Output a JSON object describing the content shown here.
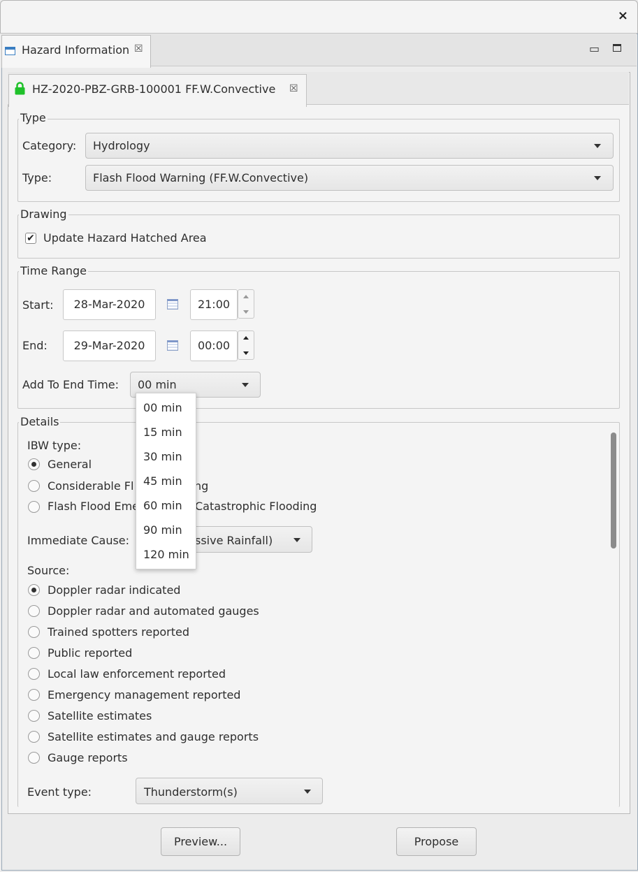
{
  "window": {
    "close_glyph": "×"
  },
  "view": {
    "tab_label": "Hazard Information",
    "tab_close_glyph": "☒",
    "minimize_glyph": "▭"
  },
  "hazard_tab": {
    "label": "HZ-2020-PBZ-GRB-100001 FF.W.Convective",
    "close_glyph": "☒",
    "lock_color": "#1fc12a"
  },
  "type_group": {
    "legend": "Type",
    "category_label": "Category:",
    "category_value": "Hydrology",
    "type_label": "Type:",
    "type_value": "Flash Flood Warning (FF.W.Convective)"
  },
  "drawing_group": {
    "legend": "Drawing",
    "update_hatched_label": "Update Hazard Hatched Area",
    "update_hatched_checked": true,
    "check_glyph": "✔"
  },
  "time_range": {
    "legend": "Time Range",
    "start_label": "Start:",
    "start_date": "28-Mar-2020",
    "start_time": "21:00",
    "end_label": "End:",
    "end_date": "29-Mar-2020",
    "end_time": "00:00",
    "add_to_end_label": "Add To End Time:",
    "add_to_end_value": "00 min"
  },
  "add_to_end_options": [
    "00 min",
    "15 min",
    "30 min",
    "45 min",
    "60 min",
    "90 min",
    "120 min"
  ],
  "details": {
    "legend": "Details",
    "ibw_label": "IBW type:",
    "ibw_options": [
      "General",
      "Considerable Fl",
      "Flash Flood Eme"
    ],
    "ibw_options_tail": [
      "",
      "ng",
      "Catastrophic Flooding"
    ],
    "ibw_selected": 0,
    "immediate_cause_label": "Immediate Cause:",
    "immediate_cause_value_visible": "ssive Rainfall)",
    "source_label": "Source:",
    "source_options": [
      "Doppler radar indicated",
      "Doppler radar and automated gauges",
      "Trained spotters reported",
      "Public reported",
      "Local law enforcement reported",
      "Emergency management reported",
      "Satellite estimates",
      "Satellite estimates and gauge reports",
      "Gauge reports"
    ],
    "source_selected": 0,
    "event_type_label": "Event type:",
    "event_type_value": "Thunderstorm(s)"
  },
  "footer": {
    "preview_label": "Preview...",
    "propose_label": "Propose"
  }
}
